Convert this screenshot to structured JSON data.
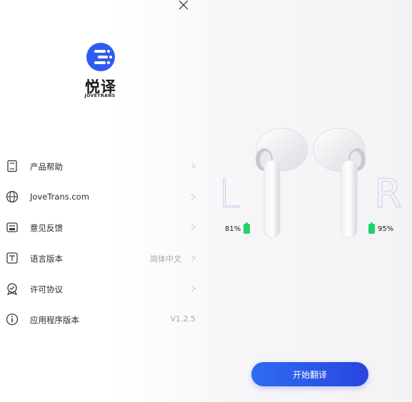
{
  "brand": {
    "name": "悦译",
    "subtitle": "JOVETRANS",
    "logo_color": "#2f5cf0"
  },
  "menu": {
    "items": [
      {
        "label": "产品帮助",
        "icon": "book-icon",
        "value": ""
      },
      {
        "label": "JoveTrans.com",
        "icon": "globe-icon",
        "value": ""
      },
      {
        "label": "意见反馈",
        "icon": "feedback-icon",
        "value": ""
      },
      {
        "label": "语言版本",
        "icon": "language-icon",
        "value": "简体中文"
      },
      {
        "label": "许可协议",
        "icon": "license-badge-icon",
        "value": ""
      },
      {
        "label": "应用程序版本",
        "icon": "info-icon",
        "value": "V1.2.5"
      }
    ]
  },
  "earbuds": {
    "left_letter": "L",
    "right_letter": "R",
    "left_battery": "81%",
    "right_battery": "95%",
    "battery_color": "#20d36a"
  },
  "actions": {
    "start_label": "开始翻译"
  }
}
